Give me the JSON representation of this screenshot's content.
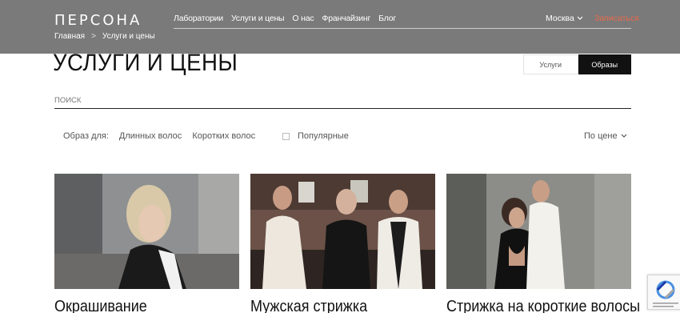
{
  "header": {
    "logo": "ПЕРСОНА",
    "nav": [
      "Лаборатории",
      "Услуги и цены",
      "О нас",
      "Франчайзинг",
      "Блог"
    ],
    "city": "Москва",
    "signup": "Записаться"
  },
  "breadcrumbs": {
    "home": "Главная",
    "separator": ">",
    "current": "Услуги и цены"
  },
  "page_title": "УСЛУГИ И ЦЕНЫ",
  "toggle": {
    "services": "Услуги",
    "looks": "Образы"
  },
  "search": {
    "placeholder": "ПОИСК"
  },
  "filters": {
    "label": "Образ для:",
    "long_hair": "Длинных волос",
    "short_hair": "Коротких волос",
    "popular": "Популярные",
    "sort": "По цене"
  },
  "cards": [
    {
      "caption": "Окрашивание"
    },
    {
      "caption": "Мужская стрижка"
    },
    {
      "caption": "Стрижка на короткие волосы"
    }
  ],
  "colors": {
    "header_bg": "#7a7a7a",
    "accent": "#e86a4a",
    "active_toggle": "#111111"
  }
}
